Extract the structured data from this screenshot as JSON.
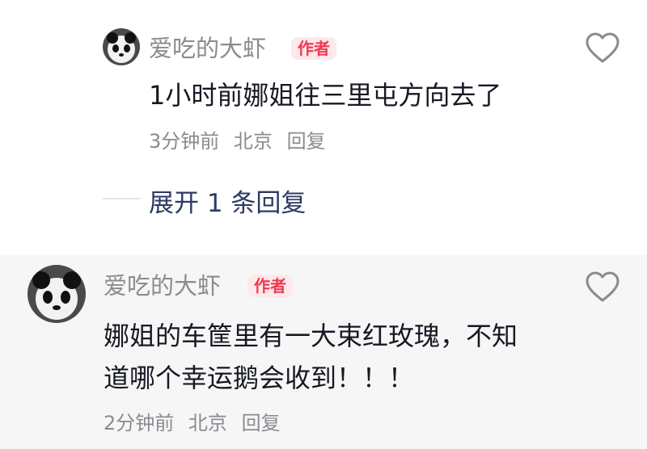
{
  "reply_comment": {
    "username": "爱吃的大虾",
    "badge": "作者",
    "text": "1小时前娜姐往三里屯方向去了",
    "time": "3分钟前",
    "location": "北京",
    "reply_label": "回复"
  },
  "expand": {
    "label": "展开 1 条回复"
  },
  "main_comment": {
    "username": "爱吃的大虾",
    "badge": "作者",
    "text_line1": "娜姐的车筐里有一大束红玫瑰，不知",
    "text_line2": "道哪个幸运鹅会收到！！！",
    "time": "2分钟前",
    "location": "北京",
    "reply_label": "回复"
  },
  "icons": {
    "like": "heart-outline-icon",
    "avatar": "panda-avatar"
  },
  "colors": {
    "badge_bg": "#fde8ea",
    "badge_text": "#f0384f",
    "expand_text": "#2d3a63",
    "secondary_text": "#8a8b91",
    "highlight_bg": "#f6f6f6"
  }
}
